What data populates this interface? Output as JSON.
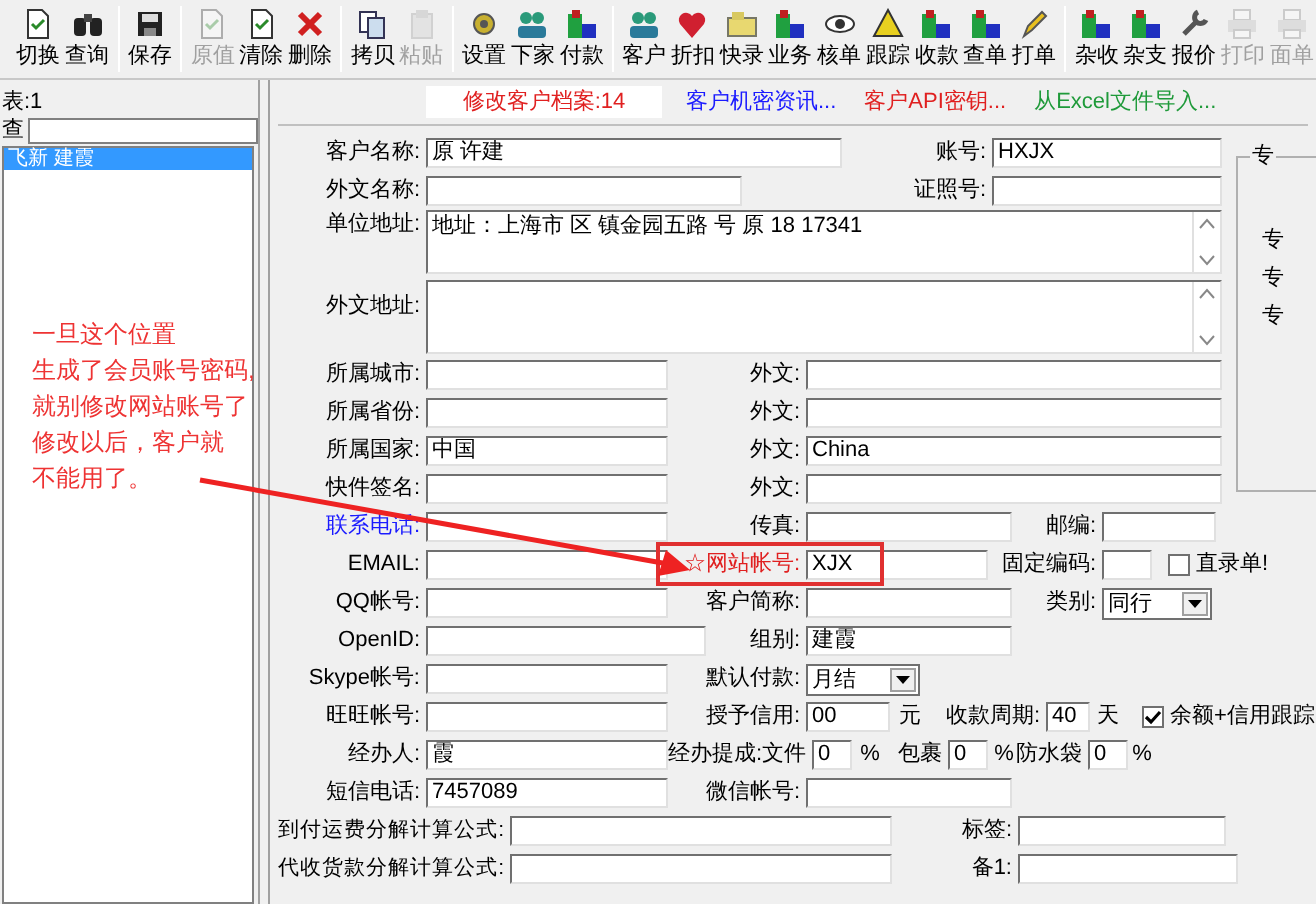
{
  "toolbar": {
    "groups": [
      {
        "buttons": [
          {
            "label": "切换",
            "disabled": false
          },
          {
            "label": "查询",
            "disabled": false
          }
        ]
      },
      {
        "buttons": [
          {
            "label": "保存",
            "disabled": false
          }
        ]
      },
      {
        "buttons": [
          {
            "label": "原值",
            "disabled": true
          },
          {
            "label": "清除",
            "disabled": false
          },
          {
            "label": "删除",
            "disabled": false
          }
        ]
      },
      {
        "buttons": [
          {
            "label": "拷贝",
            "disabled": false
          },
          {
            "label": "粘贴",
            "disabled": true
          }
        ]
      },
      {
        "buttons": [
          {
            "label": "设置",
            "disabled": false
          },
          {
            "label": "下家",
            "disabled": false
          },
          {
            "label": "付款",
            "disabled": false
          }
        ]
      },
      {
        "buttons": [
          {
            "label": "客户",
            "disabled": false
          },
          {
            "label": "折扣",
            "disabled": false
          },
          {
            "label": "快录",
            "disabled": false
          },
          {
            "label": "业务",
            "disabled": false
          },
          {
            "label": "核单",
            "disabled": false
          },
          {
            "label": "跟踪",
            "disabled": false
          },
          {
            "label": "收款",
            "disabled": false
          },
          {
            "label": "查单",
            "disabled": false
          },
          {
            "label": "打单",
            "disabled": false
          }
        ]
      },
      {
        "buttons": [
          {
            "label": "杂收",
            "disabled": false
          },
          {
            "label": "杂支",
            "disabled": false
          },
          {
            "label": "报价",
            "disabled": false
          },
          {
            "label": "打印",
            "disabled": true
          },
          {
            "label": "面单",
            "disabled": true
          }
        ]
      }
    ]
  },
  "sidebar": {
    "table_label": "表:1",
    "search_label": "查",
    "items": [
      {
        "text": "飞新 建霞",
        "selected": true
      }
    ]
  },
  "tabs": [
    {
      "label": "修改客户档案:14",
      "selected": true,
      "color": "#e02020"
    },
    {
      "label": "客户机密资讯...",
      "selected": false,
      "color": "#1a1aff"
    },
    {
      "label": "客户API密钥...",
      "selected": false,
      "color": "#e02020"
    },
    {
      "label": "从Excel文件导入...",
      "selected": false,
      "color": "#1f9a3a"
    }
  ],
  "form": {
    "rows": [
      {
        "items": [
          {
            "kind": "label",
            "text": "客户名称:"
          },
          {
            "kind": "field",
            "value": "原 许建"
          },
          {
            "kind": "label",
            "text": "账号:"
          },
          {
            "kind": "field",
            "value": "HXJX"
          }
        ]
      },
      {
        "items": [
          {
            "kind": "label",
            "text": "外文名称:"
          },
          {
            "kind": "field",
            "value": ""
          },
          {
            "kind": "label",
            "text": "证照号:"
          },
          {
            "kind": "field",
            "value": ""
          }
        ]
      },
      {
        "items": [
          {
            "kind": "label",
            "text": "单位地址:"
          },
          {
            "kind": "textarea",
            "value": "地址：上海市 区 镇金园五路 号 原 18 17341"
          }
        ]
      },
      {
        "items": [
          {
            "kind": "label",
            "text": "外文地址:"
          },
          {
            "kind": "textarea",
            "value": ""
          }
        ]
      },
      {
        "items": [
          {
            "kind": "label",
            "text": "所属城市:"
          },
          {
            "kind": "field",
            "value": ""
          },
          {
            "kind": "label",
            "text": "外文:"
          },
          {
            "kind": "field",
            "value": ""
          }
        ]
      },
      {
        "items": [
          {
            "kind": "label",
            "text": "所属省份:"
          },
          {
            "kind": "field",
            "value": ""
          },
          {
            "kind": "label",
            "text": "外文:"
          },
          {
            "kind": "field",
            "value": ""
          }
        ]
      },
      {
        "items": [
          {
            "kind": "label",
            "text": "所属国家:"
          },
          {
            "kind": "field",
            "value": "中国"
          },
          {
            "kind": "label",
            "text": "外文:"
          },
          {
            "kind": "field",
            "value": "China"
          }
        ]
      },
      {
        "items": [
          {
            "kind": "label",
            "text": "快件签名:"
          },
          {
            "kind": "field",
            "value": ""
          },
          {
            "kind": "label",
            "text": "外文:"
          },
          {
            "kind": "field",
            "value": ""
          }
        ]
      },
      {
        "items": [
          {
            "kind": "label",
            "text": "联系电话:",
            "color": "#1a1aff"
          },
          {
            "kind": "field",
            "value": ""
          },
          {
            "kind": "label",
            "text": "传真:"
          },
          {
            "kind": "field",
            "value": ""
          },
          {
            "kind": "label",
            "text": "邮编:"
          },
          {
            "kind": "field",
            "value": ""
          }
        ]
      },
      {
        "items": [
          {
            "kind": "label",
            "text": "EMAIL:"
          },
          {
            "kind": "field",
            "value": ""
          },
          {
            "kind": "label",
            "text": "☆网站帐号:",
            "color": "#e02020",
            "highlighted": true
          },
          {
            "kind": "field",
            "value": "XJX"
          },
          {
            "kind": "label",
            "text": "固定编码:"
          },
          {
            "kind": "field",
            "value": ""
          },
          {
            "kind": "checkbox",
            "text": "直录单!",
            "checked": false
          }
        ]
      },
      {
        "items": [
          {
            "kind": "label",
            "text": "QQ帐号:"
          },
          {
            "kind": "field",
            "value": ""
          },
          {
            "kind": "label",
            "text": "客户简称:"
          },
          {
            "kind": "field",
            "value": ""
          },
          {
            "kind": "label",
            "text": "类别:"
          },
          {
            "kind": "select",
            "value": "同行"
          }
        ]
      },
      {
        "items": [
          {
            "kind": "label",
            "text": "OpenID:"
          },
          {
            "kind": "field",
            "value": ""
          },
          {
            "kind": "label",
            "text": "组别:"
          },
          {
            "kind": "field",
            "value": "建霞"
          }
        ]
      },
      {
        "items": [
          {
            "kind": "label",
            "text": "Skype帐号:"
          },
          {
            "kind": "field",
            "value": ""
          },
          {
            "kind": "label",
            "text": "默认付款:"
          },
          {
            "kind": "select",
            "value": "月结"
          }
        ]
      },
      {
        "items": [
          {
            "kind": "label",
            "text": "旺旺帐号:"
          },
          {
            "kind": "field",
            "value": ""
          },
          {
            "kind": "label",
            "text": "授予信用:"
          },
          {
            "kind": "field",
            "value": "00"
          },
          {
            "kind": "unit",
            "text": "元"
          },
          {
            "kind": "label",
            "text": "收款周期:"
          },
          {
            "kind": "field",
            "value": "40"
          },
          {
            "kind": "unit",
            "text": "天"
          },
          {
            "kind": "checkbox",
            "text": "余额+信用跟踪",
            "checked": true
          }
        ]
      },
      {
        "items": [
          {
            "kind": "label",
            "text": "经办人:"
          },
          {
            "kind": "field",
            "value": "霞"
          },
          {
            "kind": "label",
            "text": "经办提成:文件"
          },
          {
            "kind": "field",
            "value": "0"
          },
          {
            "kind": "unit",
            "text": "%"
          },
          {
            "kind": "label",
            "text": "包裹"
          },
          {
            "kind": "field",
            "value": "0"
          },
          {
            "kind": "unit",
            "text": "%"
          },
          {
            "kind": "label",
            "text": "防水袋"
          },
          {
            "kind": "field",
            "value": "0"
          },
          {
            "kind": "unit",
            "text": "%"
          }
        ]
      },
      {
        "items": [
          {
            "kind": "label",
            "text": "短信电话:"
          },
          {
            "kind": "field",
            "value": "7457089"
          },
          {
            "kind": "label",
            "text": "微信帐号:"
          },
          {
            "kind": "field",
            "value": ""
          }
        ]
      },
      {
        "items": [
          {
            "kind": "label",
            "text": "到付运费分解计算公式:"
          },
          {
            "kind": "field",
            "value": ""
          },
          {
            "kind": "label",
            "text": "标签:"
          },
          {
            "kind": "field",
            "value": ""
          }
        ]
      },
      {
        "items": [
          {
            "kind": "label",
            "text": "代收货款分解计算公式:"
          },
          {
            "kind": "field",
            "value": ""
          },
          {
            "kind": "label",
            "text": "备1:"
          },
          {
            "kind": "field",
            "value": ""
          }
        ]
      }
    ]
  },
  "side_group": {
    "title": "专",
    "labels": [
      "专",
      "专",
      "专"
    ]
  },
  "annotation": {
    "lines": [
      "一旦这个位置",
      "生成了会员账号密码,",
      "就别修改网站账号了",
      "修改以后，客户就",
      "不能用了。"
    ]
  }
}
